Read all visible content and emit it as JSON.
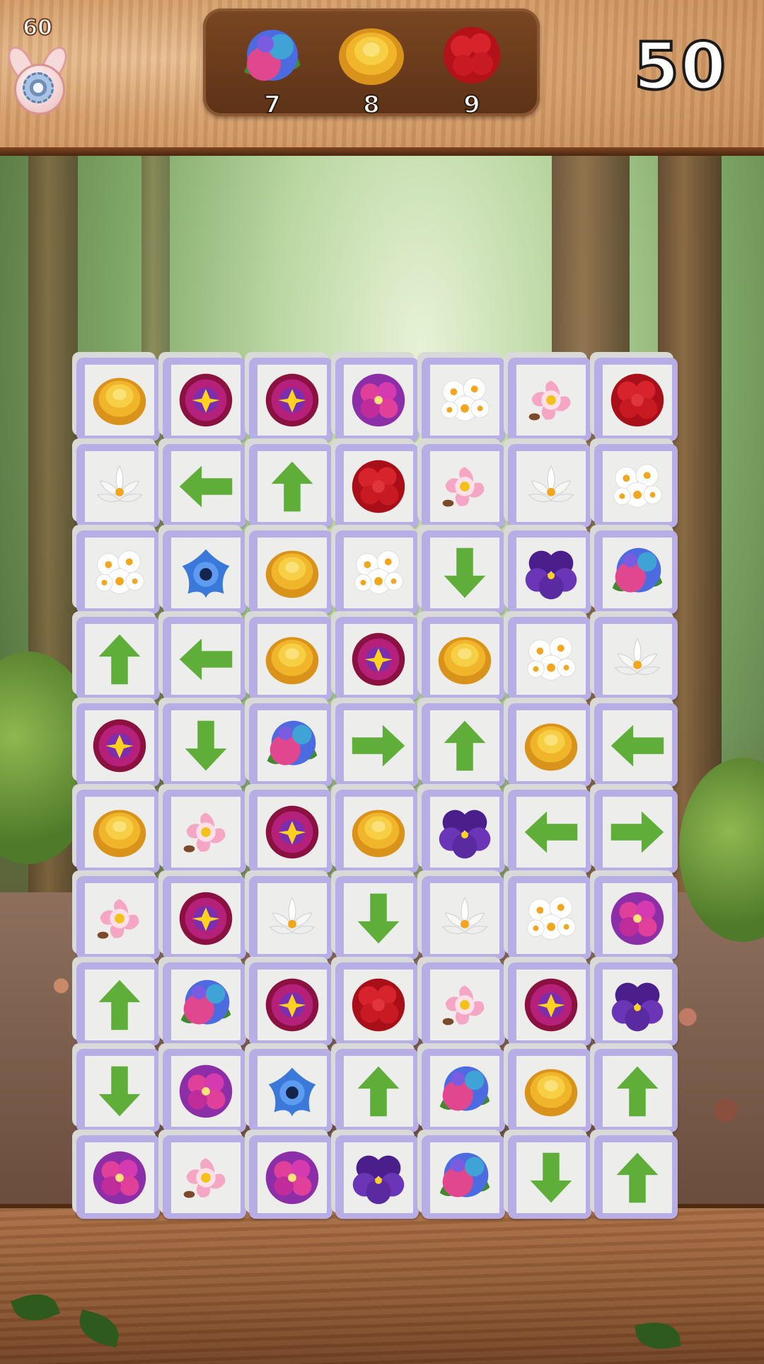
{
  "hud": {
    "level": "60",
    "moves": "50",
    "settings_icon": "gear-icon",
    "goals": [
      {
        "flower": "hydrangea",
        "count": "7"
      },
      {
        "flower": "yellow-ranunculus",
        "count": "8"
      },
      {
        "flower": "red-geranium",
        "count": "9"
      }
    ]
  },
  "board": {
    "rows": 10,
    "cols": 7,
    "tiles": [
      [
        "yellow",
        "primula",
        "primula",
        "magenta",
        "daisy",
        "pink",
        "red"
      ],
      [
        "lotus",
        "left",
        "up",
        "red",
        "pink",
        "lotus",
        "daisy"
      ],
      [
        "daisy",
        "blue",
        "yellow",
        "daisy",
        "down",
        "violet",
        "hydrangea"
      ],
      [
        "up",
        "left",
        "yellow",
        "primula",
        "yellow",
        "daisy",
        "lotus"
      ],
      [
        "primula",
        "down",
        "hydrangea",
        "right",
        "up",
        "yellow",
        "left"
      ],
      [
        "yellow",
        "pink",
        "primula",
        "yellow",
        "violet",
        "left",
        "right"
      ],
      [
        "pink",
        "primula",
        "lotus",
        "down",
        "lotus",
        "daisy",
        "magenta"
      ],
      [
        "up",
        "hydrangea",
        "primula",
        "red",
        "pink",
        "primula",
        "violet"
      ],
      [
        "down",
        "magenta",
        "blue",
        "up",
        "hydrangea",
        "yellow",
        "up"
      ],
      [
        "magenta",
        "pink",
        "magenta",
        "violet",
        "hydrangea",
        "down",
        "up"
      ]
    ]
  },
  "colors": {
    "tile_face": "#ededec",
    "tile_border": "#b8aee6",
    "arrow_green": "#5fae3a"
  }
}
